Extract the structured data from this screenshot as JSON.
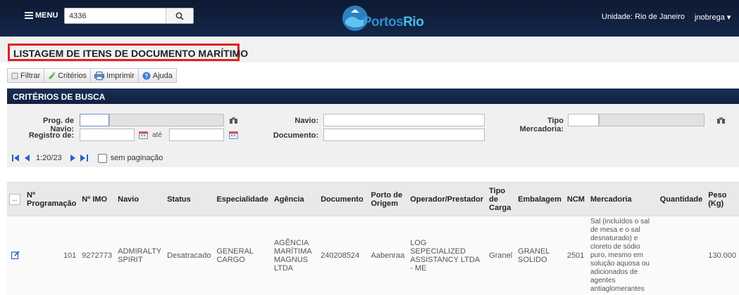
{
  "topbar": {
    "menu_label": "MENU",
    "search_value": "4336",
    "brand_part1": "Portos",
    "brand_part2": "Rio",
    "unit": "Unidade: Rio de Janeiro",
    "user": "jnobrega"
  },
  "page": {
    "title": "LISTAGEM DE ITENS DE DOCUMENTO MARÍTIMO"
  },
  "toolbar": {
    "filter": "Filtrar",
    "criteria": "Critérios",
    "print": "Imprimir",
    "help": "Ajuda"
  },
  "criteria": {
    "header": "CRITÉRIOS DE BUSCA",
    "prog_label": "Prog. de Navio:",
    "registro_label": "Registro de:",
    "ate_label": "até",
    "navio_label": "Navio:",
    "documento_label": "Documento:",
    "tipo_label": "Tipo Mercadoria:"
  },
  "pager": {
    "range": "1:20/23",
    "no_pagination": "sem paginação"
  },
  "table": {
    "headers": [
      "...",
      "Nº Programação",
      "Nº IMO",
      "Navio",
      "Status",
      "Especialidade",
      "Agência",
      "Documento",
      "Porto de Origem",
      "Operador/Prestador",
      "Tipo de Carga",
      "Embalagem",
      "NCM",
      "Mercadoria",
      "Quantidade",
      "Peso (Kg)"
    ],
    "rows": [
      {
        "programacao": "101",
        "imo": "9272773",
        "navio": "ADMIRALTY SPIRIT",
        "status": "Desatracado",
        "especialidade": "GENERAL CARGO",
        "agencia": "AGÊNCIA MARÍTIMA MAGNUS LTDA",
        "documento": "240208524",
        "porto": "Aabenraa",
        "operador": "LOG SEPECIALIZED ASSISTANCY LTDA - ME",
        "tipo": "Granel",
        "embalagem": "GRANEL SOLIDO",
        "ncm": "2501",
        "mercadoria": "Sal (incluídos o sal de mesa e o sal desnaturado) e cloreto de sódio puro, mesmo em solução aquosa ou adicionados de agentes antiaglomerantes",
        "quantidade": "",
        "peso": "130.000"
      }
    ]
  },
  "colors": {
    "header_bg": "#14264a",
    "title_border": "#e02020",
    "brand_blue": "#2d8fcf"
  }
}
